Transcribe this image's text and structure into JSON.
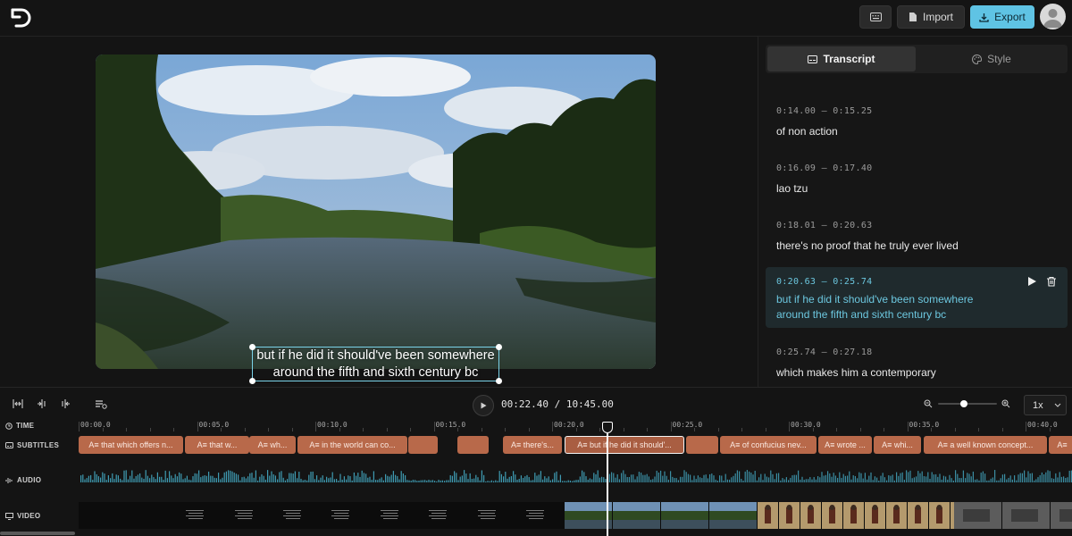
{
  "header": {
    "import_label": "Import",
    "export_label": "Export",
    "accent_color": "#5fc3e4"
  },
  "preview": {
    "subtitle_line1": "but if he did it should've been somewhere",
    "subtitle_line2": "around the fifth and sixth century bc"
  },
  "panel": {
    "tabs": [
      {
        "label": "Transcript",
        "icon": "subtitles-icon",
        "active": true
      },
      {
        "label": "Style",
        "icon": "palette-icon",
        "active": false
      }
    ],
    "entries": [
      {
        "start": "0:14.00",
        "end": "0:15.25",
        "text": "of non action"
      },
      {
        "start": "0:16.09",
        "end": "0:17.40",
        "text": "lao tzu"
      },
      {
        "start": "0:18.01",
        "end": "0:20.63",
        "text": "there's no proof that he truly ever lived"
      },
      {
        "start": "0:20.63",
        "end": "0:25.74",
        "text_line1": "but if he did it should've been somewhere",
        "text_line2": "around the fifth and sixth century bc",
        "active": true
      },
      {
        "start": "0:25.74",
        "end": "0:27.18",
        "text": "which makes him a contemporary"
      }
    ]
  },
  "timeline": {
    "current_time": "00:22.40",
    "total_time": "10:45.00",
    "speed": "1x",
    "labels": {
      "time": "TIME",
      "subtitles": "SUBTITLES",
      "audio": "AUDIO",
      "video": "VIDEO"
    },
    "ruler": [
      "00:00.0",
      "00:05.0",
      "00:10.0",
      "00:15.0",
      "00:20.0",
      "00:25.0",
      "00:30.0",
      "00:35.0",
      "00:40.0"
    ],
    "clips": [
      "A≡ that which offers n...",
      "A≡ that w...",
      "A≡ wh...",
      "A≡ in the world can co...",
      "",
      "",
      "A≡ there's...",
      "A≡ but if he did it should'...",
      "",
      "A≡ of confucius nev...",
      "A≡ wrote ...",
      "A≡ whi...",
      "A≡ a well known concept...",
      "A≡"
    ],
    "clip_color": "#b8694a"
  }
}
